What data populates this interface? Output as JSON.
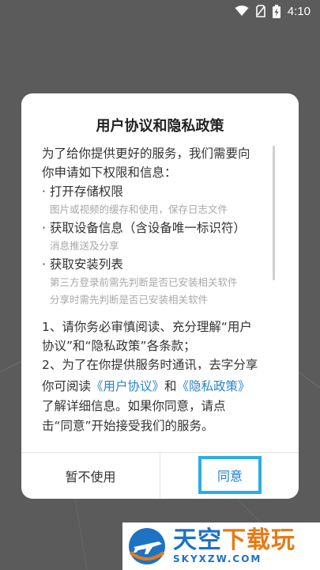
{
  "status_bar": {
    "time": "4:10"
  },
  "dialog": {
    "title": "用户协议和隐私政策",
    "intro_line1": "为了给你提供更好的服务，我们需要向",
    "intro_line2": "你申请如下权限和信息：",
    "permissions": [
      {
        "title": "· 打开存储权限",
        "desc": [
          "图片或视频的缓存和使用，保存日志文件"
        ]
      },
      {
        "title": "· 获取设备信息（含设备唯一标识符）",
        "desc": [
          "消息推送及分享"
        ]
      },
      {
        "title": "· 获取安装列表",
        "desc": [
          "第三方登录前需先判断是否已安装相关软件",
          "分享时需先判断是否已安装相关软件"
        ]
      }
    ],
    "clause_line1": "1、请你务必审慎阅读、充分理解“用户",
    "clause_line2": "协议”和“隐私政策”各条款；",
    "clause_line3": "2、为了在你提供服务时通讯，去字分享",
    "bottom": {
      "t1": "你可阅读",
      "link1": "《用户协议》",
      "t2": "和",
      "link2": "《隐私政策》",
      "t3": "了解详细信息。如果你同意，请点",
      "t4": "击“同意”开始接受我们的服务。"
    },
    "cancel_label": "暂不使用",
    "agree_label": "同意"
  },
  "watermark": {
    "cn_part1": "天空",
    "cn_part2": "下载玩",
    "en": "SKYXZW.COM"
  },
  "colors": {
    "link": "#2a84c7",
    "agree_border": "#29aee6",
    "backdrop": "#5b5b5b"
  }
}
